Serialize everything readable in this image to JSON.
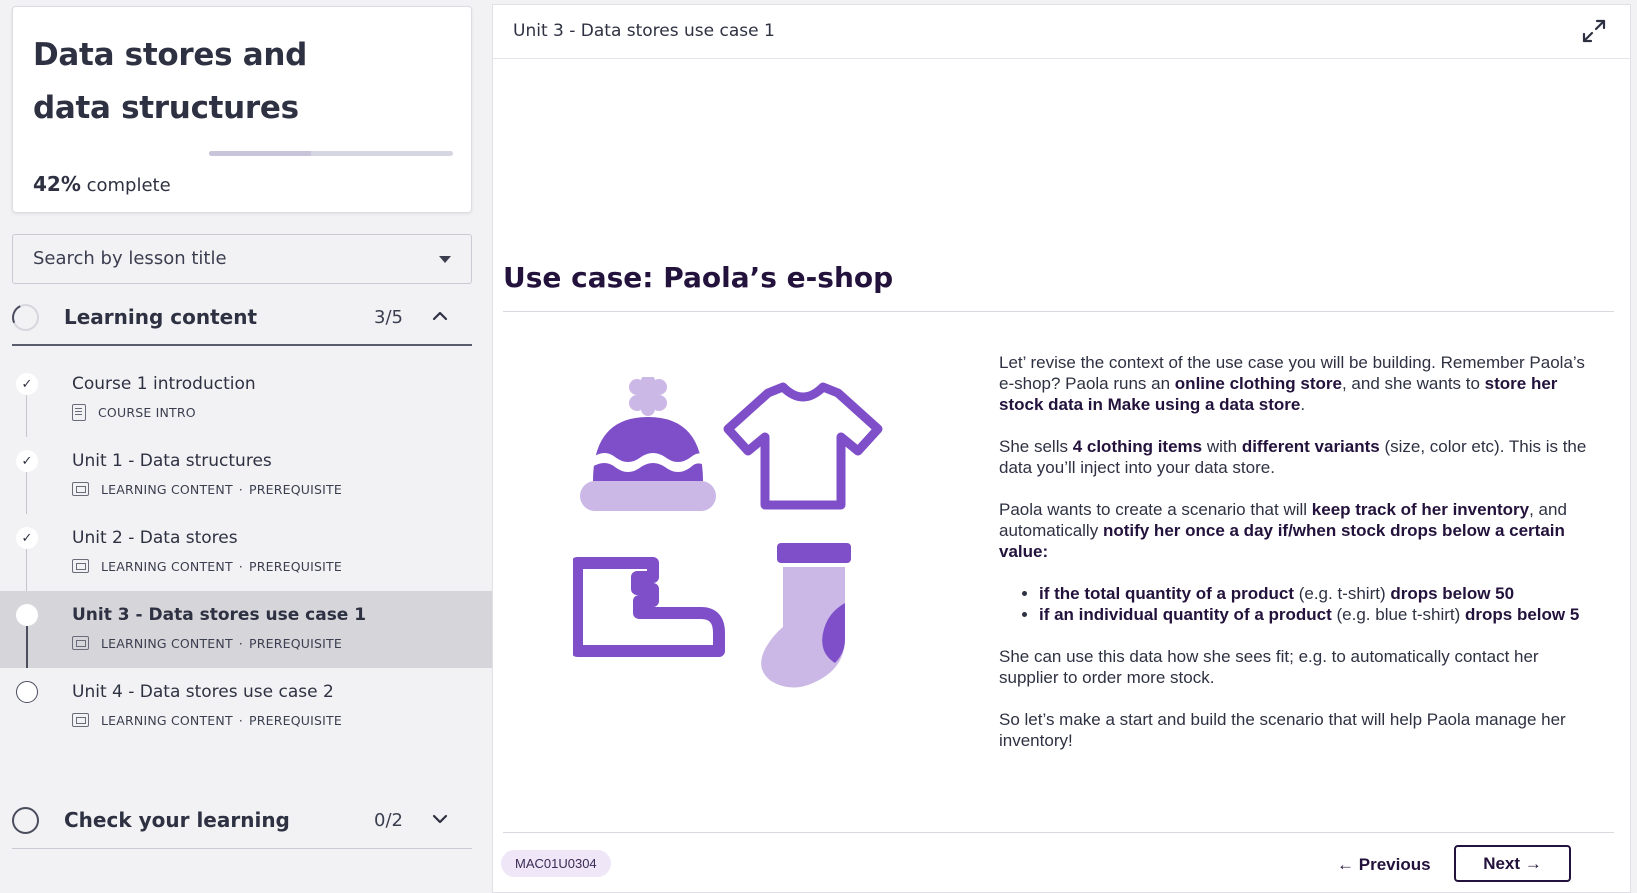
{
  "course": {
    "title": "Data stores and data structures",
    "progress_percent": 42,
    "progress_value": "42%",
    "progress_suffix": "complete"
  },
  "search": {
    "placeholder": "Search by lesson title"
  },
  "sections": [
    {
      "title": "Learning content",
      "count": "3/5",
      "expanded": true,
      "lessons": [
        {
          "title": "Course 1 introduction",
          "type": "COURSE INTRO",
          "tag": "",
          "status": "done",
          "icon": "document-icon"
        },
        {
          "title": "Unit 1 - Data structures",
          "type": "LEARNING CONTENT",
          "tag": "PREREQUISITE",
          "status": "done",
          "icon": "slides-icon"
        },
        {
          "title": "Unit 2 - Data stores",
          "type": "LEARNING CONTENT",
          "tag": "PREREQUISITE",
          "status": "done",
          "icon": "slides-icon"
        },
        {
          "title": "Unit 3 - Data stores use case 1",
          "type": "LEARNING CONTENT",
          "tag": "PREREQUISITE",
          "status": "current",
          "icon": "slides-icon"
        },
        {
          "title": "Unit 4 - Data stores use case 2",
          "type": "LEARNING CONTENT",
          "tag": "PREREQUISITE",
          "status": "open",
          "icon": "slides-icon"
        }
      ]
    },
    {
      "title": "Check your learning",
      "count": "0/2",
      "expanded": false
    }
  ],
  "meta_separator": "·",
  "main": {
    "unit_title": "Unit 3 - Data stores use case 1",
    "heading": "Use case: Paola’s e-shop",
    "code": "MAC01U0304",
    "prev_label": "Previous",
    "next_label": "Next",
    "illustration": [
      "beanie-hat-icon",
      "t-shirt-icon",
      "sneaker-icon",
      "sock-icon"
    ],
    "paragraphs": {
      "p1_a": "Let’ revise the context of the use case you will be building. Remember Paola’s e-shop? Paola runs an ",
      "p1_b": "online clothing store",
      "p1_c": ", and she wants to ",
      "p1_d": "store her stock data in Make using a data store",
      "p1_e": ".",
      "p2_a": "She sells ",
      "p2_b": "4 clothing items",
      "p2_c": " with ",
      "p2_d": "different variants",
      "p2_e": " (size, color etc). This is the data you’ll inject into your data store.",
      "p3_a": "Paola wants to create a scenario that will ",
      "p3_b": "keep track of her inventory",
      "p3_c": ", and automatically ",
      "p3_d": "notify her once a day if/when stock drops below a certain value:",
      "li1_a": "if the total quantity of a product",
      "li1_b": " (e.g. t-shirt) ",
      "li1_c": "drops below 50",
      "li2_a": "if an individual quantity of a product",
      "li2_b": " (e.g. blue t-shirt) ",
      "li2_c": "drops below 5",
      "p4": "She can use this data how she sees fit; e.g. to automatically contact her supplier to order more stock.",
      "p5": "So let’s make a start and build the scenario that will help Paola manage her inventory!"
    }
  },
  "colors": {
    "purple_dark": "#7e4fc8",
    "purple_light": "#cbb8e6",
    "heading": "#23123c",
    "badge_bg": "#efe6f7"
  }
}
